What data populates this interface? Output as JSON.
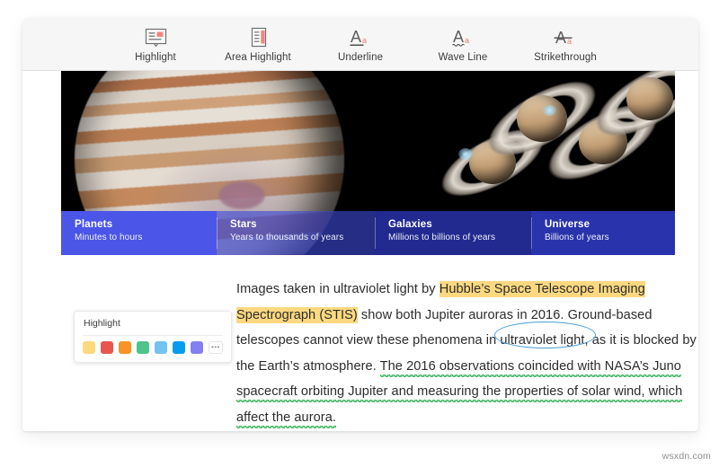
{
  "toolbar": {
    "tools": [
      {
        "label": "Highlight",
        "icon": "highlight-icon"
      },
      {
        "label": "Area Highlight",
        "icon": "area-highlight-icon"
      },
      {
        "label": "Underline",
        "icon": "underline-icon"
      },
      {
        "label": "Wave Line",
        "icon": "wave-line-icon"
      },
      {
        "label": "Strikethrough",
        "icon": "strikethrough-icon"
      }
    ]
  },
  "hero": {
    "alt": "Jupiter and Saturn photographed by Hubble on a black background",
    "banner": [
      {
        "title": "Planets",
        "subtitle": "Minutes to hours"
      },
      {
        "title": "Stars",
        "subtitle": "Years to thousands of years"
      },
      {
        "title": "Galaxies",
        "subtitle": "Millions to billions of years"
      },
      {
        "title": "Universe",
        "subtitle": "Billions of years"
      }
    ]
  },
  "article": {
    "seg_plain_1": "Images taken in ultraviolet light by ",
    "seg_highlight_1": "Hubble’s Space Telescope Imaging Spectrograph (STIS)",
    "seg_plain_2": " show both Jupiter auroras in 2016. Ground-based telescopes cannot view these phenomena in ",
    "seg_circled": "ultraviolet light,",
    "seg_plain_3": " as it is blocked by  the Earth’s atmosphere. ",
    "seg_wavy": "The 2016 observations coincided with NASA’s Juno  spacecraft orbiting Jupiter and measuring the properties of solar wind, which affect the aurora."
  },
  "popup": {
    "title": "Highlight",
    "more_label": "•••",
    "colors": [
      {
        "name": "yellow",
        "hex": "#fcd97f"
      },
      {
        "name": "red",
        "hex": "#e9564f"
      },
      {
        "name": "orange",
        "hex": "#f79327"
      },
      {
        "name": "green",
        "hex": "#4ec48b"
      },
      {
        "name": "light-blue",
        "hex": "#74c2f0"
      },
      {
        "name": "blue",
        "hex": "#089cf0"
      },
      {
        "name": "purple",
        "hex": "#8281ef"
      }
    ]
  },
  "watermark": {
    "text": "wsxdn.com"
  },
  "colors": {
    "highlight_yellow": "#fcd980",
    "circle_blue": "#4a9fd8",
    "wavy_green": "#49b86a",
    "banner_blue": "#4b55e8",
    "icon_accent": "#f07a72"
  }
}
